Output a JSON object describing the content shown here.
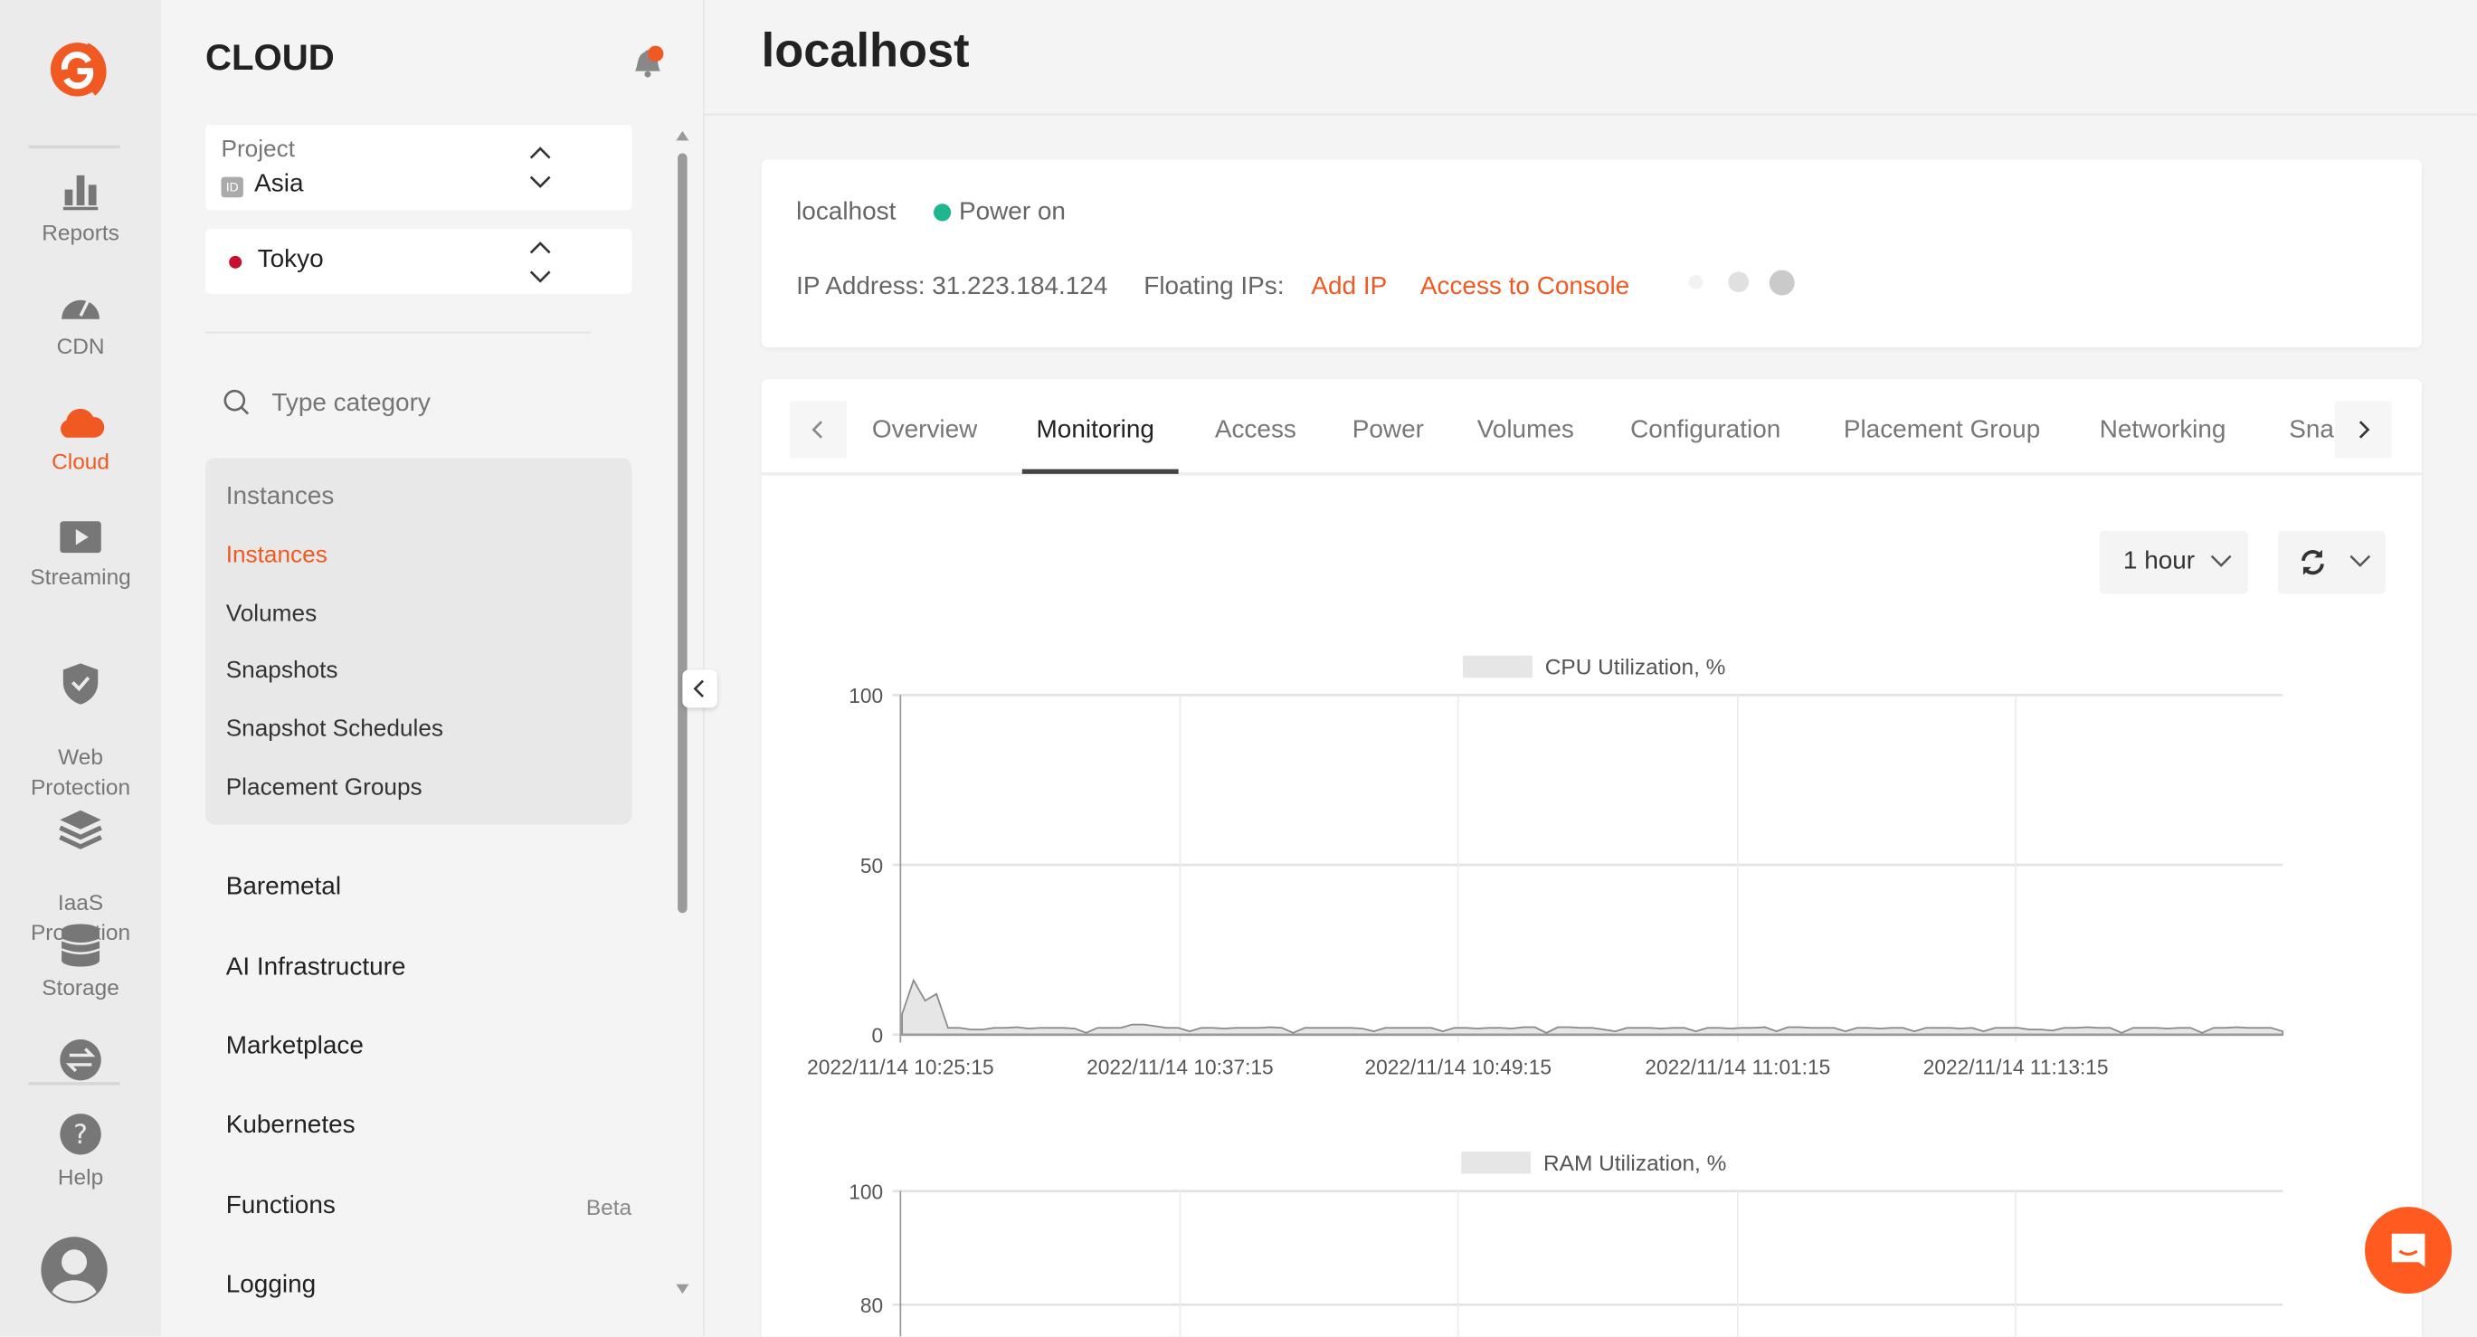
{
  "rail": {
    "items": [
      {
        "label": "Reports",
        "icon": "bar-chart-icon"
      },
      {
        "label": "CDN",
        "icon": "speedometer-icon"
      },
      {
        "label": "Cloud",
        "icon": "cloud-icon",
        "active": true
      },
      {
        "label": "Streaming",
        "icon": "play-icon"
      },
      {
        "label": "Web\nProtection",
        "icon": "shield-icon"
      },
      {
        "label": "IaaS\nProtection",
        "icon": "layers-icon"
      },
      {
        "label": "Storage",
        "icon": "database-icon"
      },
      {
        "label": "",
        "icon": "swap-icon"
      },
      {
        "label": "Help",
        "icon": "help-icon"
      }
    ]
  },
  "sidebar": {
    "title": "CLOUD",
    "project_label": "Project",
    "project_badge": "ID",
    "project_value": "Asia",
    "region_value": "Tokyo",
    "search_placeholder": "Type category",
    "group_header": "Instances",
    "group_items": [
      "Instances",
      "Volumes",
      "Snapshots",
      "Snapshot Schedules",
      "Placement Groups"
    ],
    "menu": [
      "Baremetal",
      "AI Infrastructure",
      "Marketplace",
      "Kubernetes",
      "Functions",
      "Logging"
    ],
    "functions_badge": "Beta"
  },
  "header": {
    "title": "localhost"
  },
  "instance": {
    "name": "localhost",
    "status": "Power on",
    "ip": "IP Address: 31.223.184.124",
    "floating_label": "Floating IPs:",
    "add_ip": "Add IP",
    "console": "Access to Console"
  },
  "tabs": [
    "Overview",
    "Monitoring",
    "Access",
    "Power",
    "Volumes",
    "Configuration",
    "Placement Group",
    "Networking",
    "Sna"
  ],
  "active_tab": "Monitoring",
  "controls": {
    "period": "1 hour"
  },
  "colors": {
    "accent": "#f05a22",
    "status_green": "#1fb58f",
    "series_fill": "#e6e6e6",
    "series_line": "#888888"
  },
  "chart_data": [
    {
      "type": "area",
      "legend": "CPU Utilization, %",
      "legend_position": "top",
      "ylim": [
        0,
        100
      ],
      "y_ticks": [
        "100",
        "50",
        "0"
      ],
      "x_ticks": [
        "2022/11/14 10:25:15",
        "2022/11/14 10:37:15",
        "2022/11/14 10:49:15",
        "2022/11/14 11:01:15",
        "2022/11/14 11:13:15"
      ],
      "x_range": [
        "2022/11/14 10:25:15",
        "2022/11/14 11:24:45"
      ],
      "grid": true,
      "values": [
        6,
        16,
        10,
        12,
        2,
        2,
        1.5,
        1.5,
        2,
        2,
        2.2,
        1.8,
        2,
        2,
        2,
        1.8,
        0.5,
        2,
        2,
        2,
        3,
        3,
        2.5,
        2,
        2,
        1,
        2,
        2,
        1.8,
        2,
        2,
        2,
        2.2,
        2,
        0.5,
        2,
        2,
        2,
        2,
        2,
        1.8,
        1,
        2,
        2,
        2,
        2,
        2,
        1,
        2,
        2,
        1.8,
        2,
        2,
        1.8,
        2.2,
        2.2,
        0.5,
        2.2,
        2.2,
        2,
        2,
        1.5,
        1,
        2,
        2,
        2,
        1.8,
        2,
        2,
        1,
        2,
        2,
        1.8,
        2,
        2,
        2.2,
        1,
        2.2,
        2.2,
        2,
        2,
        2,
        1,
        2,
        2,
        1.8,
        2,
        2,
        1,
        2,
        2,
        2,
        1.8,
        2,
        1,
        2,
        2,
        2,
        1.5,
        1.5,
        1.2,
        2,
        2,
        2.2,
        2,
        2,
        0.5,
        2,
        2,
        2,
        1.8,
        2,
        2,
        0.5,
        2,
        2,
        2.2,
        2,
        2,
        2,
        1
      ]
    },
    {
      "type": "area",
      "legend": "RAM Utilization, %",
      "legend_position": "top",
      "y_ticks": [
        "100",
        "80"
      ],
      "x_ticks": [],
      "grid": true,
      "values": []
    }
  ]
}
